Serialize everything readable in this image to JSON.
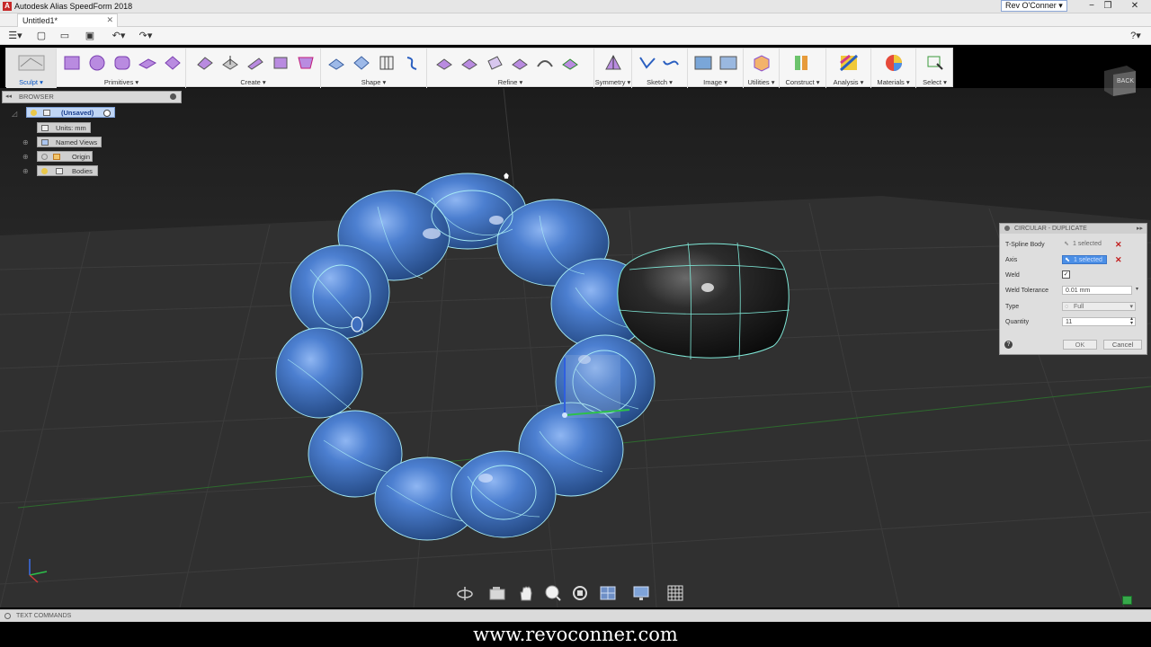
{
  "window": {
    "title": "Autodesk Alias SpeedForm 2018",
    "user": "Rev O'Conner ▾",
    "minimize": "−",
    "restore": "❐",
    "close": "✕"
  },
  "tabs": [
    {
      "label": "Untitled1*"
    }
  ],
  "qat": {
    "menu": "☰▾",
    "new": "▢",
    "open": "▭",
    "save": "▣",
    "undo": "↶▾",
    "redo": "↷▾",
    "help": "?▾"
  },
  "ribbon": {
    "groups": [
      {
        "label": "Sculpt ▾",
        "active": true
      },
      {
        "label": "Primitives ▾"
      },
      {
        "label": "Create ▾"
      },
      {
        "label": "Shape ▾"
      },
      {
        "label": "Refine ▾"
      },
      {
        "label": "Symmetry ▾"
      },
      {
        "label": "Sketch ▾"
      },
      {
        "label": "Image ▾"
      },
      {
        "label": "Utilities ▾"
      },
      {
        "label": "Construct ▾"
      },
      {
        "label": "Analysis ▾"
      },
      {
        "label": "Materials ▾"
      },
      {
        "label": "Select ▾"
      }
    ]
  },
  "browser": {
    "title": "BROWSER",
    "root": "(Unsaved)",
    "items": [
      {
        "label": "Units: mm"
      },
      {
        "label": "Named Views"
      },
      {
        "label": "Origin"
      },
      {
        "label": "Bodies"
      }
    ]
  },
  "viewcube": {
    "face": "BACK"
  },
  "panel": {
    "title": "CIRCULAR - DUPLICATE",
    "rows": [
      {
        "label": "T-Spline Body",
        "value": "1 selected"
      },
      {
        "label": "Axis",
        "value": "1 selected"
      },
      {
        "label": "Weld",
        "value": "✓"
      },
      {
        "label": "Weld Tolerance",
        "value": "0.01 mm"
      },
      {
        "label": "Type",
        "value": "Full"
      },
      {
        "label": "Quantity",
        "value": "11"
      }
    ],
    "ok": "OK",
    "cancel": "Cancel"
  },
  "command_bar": {
    "label": "TEXT COMMANDS"
  },
  "footer": {
    "text": "www.revoconner.com"
  },
  "colors": {
    "accent": "#3a7bd5",
    "body_blue": "#3f6fbf",
    "mesh_lines": "#9fe7f0",
    "ground": "#2f2f2f"
  }
}
